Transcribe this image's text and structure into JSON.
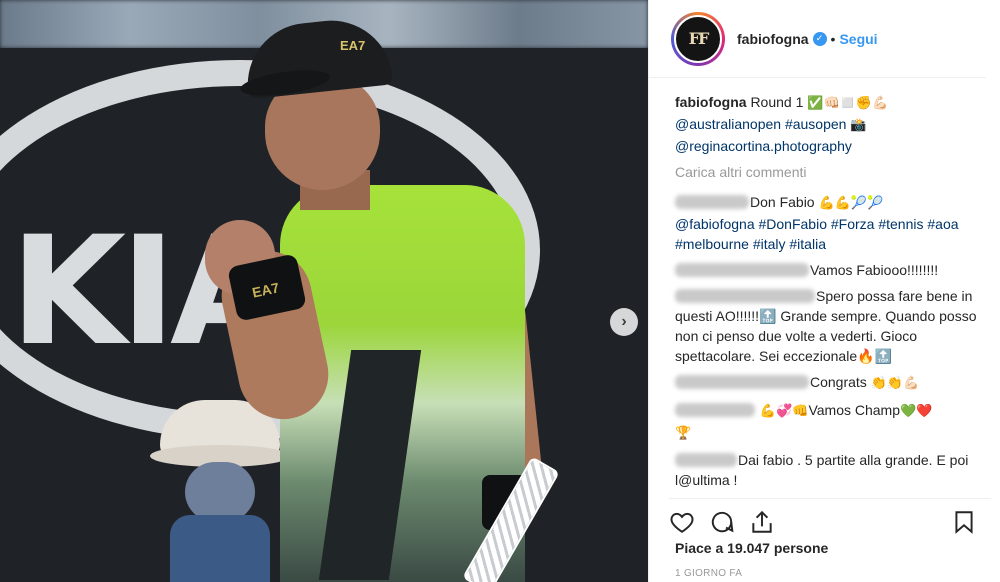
{
  "post": {
    "photo": {
      "cap_logo": "EA7",
      "band_logo": "EA7",
      "sponsor_text": "KIA",
      "next_arrow_glyph": "›"
    },
    "header": {
      "username": "fabiofogna",
      "verified_glyph": "✓",
      "separator": "•",
      "follow_label": "Segui",
      "avatar_monogram": "FF"
    },
    "caption": {
      "username": "fabiofogna",
      "text": "Round 1",
      "emojis": "✅👊🏻◻️✊💪🏻",
      "tags_line1": "@australianopen #ausopen",
      "tags_line1_emoji": "📸",
      "tags_line2": "@reginacortina.photography"
    },
    "load_more_label": "Carica altri commenti",
    "comments": [
      {
        "text": "Don Fabio",
        "emojis": "💪💪🎾🎾",
        "tags": "@fabiofogna #DonFabio #Forza #tennis #aoa #melbourne #italy #italia"
      },
      {
        "text": "Vamos Fabiooo!!!!!!!!"
      },
      {
        "text": "Spero possa fare bene in questi AO!!!!!!🔝 Grande sempre. Quando posso non ci penso due volte a vederti. Gioco spettacolare. Sei eccezionale🔥🔝"
      },
      {
        "text": "Congrats",
        "emojis": "👏👏💪🏻"
      },
      {
        "text": "Vamos Champ",
        "emojis_before": "💪💞👊",
        "emojis": "💚❤️",
        "after": "🏆"
      },
      {
        "text": "Dai fabio . 5 partite alla grande. E poi l@ultima !"
      }
    ],
    "actions": {
      "like_icon": "heart-icon",
      "comment_icon": "comment-icon",
      "share_icon": "share-icon",
      "save_icon": "bookmark-icon"
    },
    "likes_text": "Piace a 19.047 persone",
    "timestamp": "1 GIORNO FA"
  }
}
